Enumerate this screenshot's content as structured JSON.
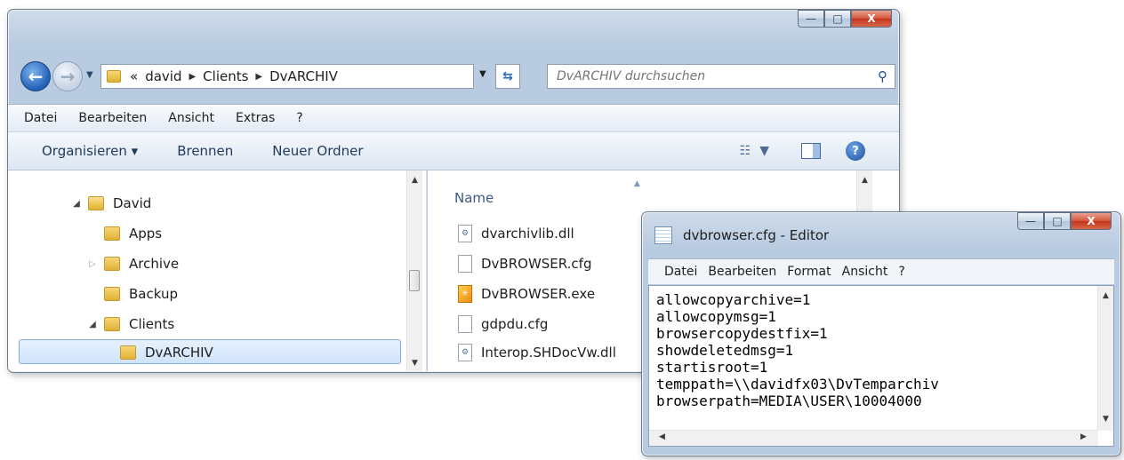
{
  "explorer": {
    "window_buttons": {
      "minimize": "—",
      "maximize": "□",
      "close": "X"
    },
    "address": {
      "overflow": "«",
      "crumbs": [
        "david",
        "Clients",
        "DvARCHIV"
      ]
    },
    "search_placeholder": "DvARCHIV durchsuchen",
    "menu": [
      "Datei",
      "Bearbeiten",
      "Ansicht",
      "Extras",
      "?"
    ],
    "commands": [
      "Organisieren ▾",
      "Brennen",
      "Neuer Ordner"
    ],
    "tree": [
      "David",
      "Apps",
      "Archive",
      "Backup",
      "Clients",
      "DvARCHIV"
    ],
    "column_header": "Name",
    "files": [
      "dvarchivlib.dll",
      "DvBROWSER.cfg",
      "DvBROWSER.exe",
      "gdpdu.cfg",
      "Interop.SHDocVw.dll"
    ]
  },
  "notepad": {
    "title": "dvbrowser.cfg - Editor",
    "window_buttons": {
      "minimize": "—",
      "maximize": "□",
      "close": "X"
    },
    "menu": [
      "Datei",
      "Bearbeiten",
      "Format",
      "Ansicht",
      "?"
    ],
    "lines": [
      "allowcopyarchive=1",
      "allowcopymsg=1",
      "browsercopydestfix=1",
      "showdeletedmsg=1",
      "startisroot=1",
      "temppath=\\\\davidfx03\\DvTemparchiv",
      "browserpath=MEDIA\\USER\\10004000"
    ]
  },
  "colors": {
    "selection": "#cfe3fb",
    "close_button": "#c4341a",
    "folder": "#e1b035"
  }
}
